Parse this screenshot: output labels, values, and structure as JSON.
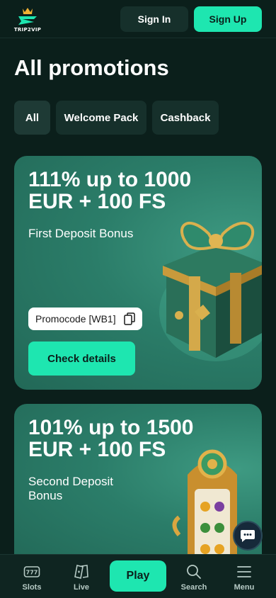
{
  "header": {
    "logo_text": "TRIP2VIP",
    "sign_in_label": "Sign In",
    "sign_up_label": "Sign Up"
  },
  "page_title": "All promotions",
  "tabs": [
    {
      "label": "All",
      "active": true
    },
    {
      "label": "Welcome Pack",
      "active": false
    },
    {
      "label": "Cashback",
      "active": false
    }
  ],
  "promotions": [
    {
      "title": "111% up to 1000 EUR + 100 FS",
      "subtitle": "First Deposit Bonus",
      "promocode": "Promocode [WB1]",
      "button_label": "Check details",
      "image_icon": "gift-box-icon"
    },
    {
      "title": "101% up to 1500 EUR + 100 FS",
      "subtitle": "Second Deposit Bonus",
      "image_icon": "slot-machine-icon"
    }
  ],
  "bottom_nav": {
    "slots_label": "Slots",
    "live_label": "Live",
    "play_label": "Play",
    "search_label": "Search",
    "menu_label": "Menu"
  },
  "colors": {
    "background": "#0b1f1b",
    "accent": "#1ee6b0",
    "card": "#2b7d69"
  }
}
